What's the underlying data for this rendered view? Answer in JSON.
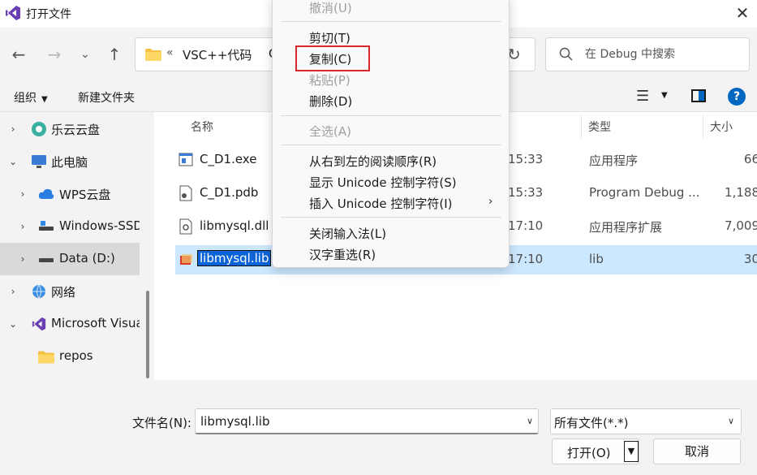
{
  "window": {
    "title": "打开文件"
  },
  "address": {
    "separator": "«",
    "crumb_1": "VSC++代码",
    "crumb_2": "C"
  },
  "search": {
    "placeholder": "在 Debug 中搜索"
  },
  "toolbar": {
    "organize": "组织",
    "new_folder": "新建文件夹"
  },
  "sidebar": {
    "items": [
      {
        "label": "乐云云盘",
        "icon": "cloud-icon",
        "expand": "collapsed"
      },
      {
        "label": "此电脑",
        "icon": "computer-icon",
        "expand": "expanded"
      },
      {
        "label": "WPS云盘",
        "icon": "cloud-icon",
        "expand": "collapsed"
      },
      {
        "label": "Windows-SSD",
        "icon": "drive-icon",
        "expand": "collapsed"
      },
      {
        "label": "Data (D:)",
        "icon": "drive-icon",
        "expand": "collapsed",
        "selected": true
      },
      {
        "label": "网络",
        "icon": "network-icon",
        "expand": "collapsed"
      },
      {
        "label": "Microsoft Visua",
        "icon": "visual-studio-icon",
        "expand": "expanded"
      },
      {
        "label": "repos",
        "icon": "folder-icon",
        "expand": "none"
      }
    ]
  },
  "columns": {
    "name": "名称",
    "type": "类型",
    "size": "大小"
  },
  "files": [
    {
      "name": "C_D1.exe",
      "date": "15:33",
      "type": "应用程序",
      "size": "66"
    },
    {
      "name": "C_D1.pdb",
      "date": "15:33",
      "type": "Program Debug ...",
      "size": "1,188"
    },
    {
      "name": "libmysql.dll",
      "date": "17:10",
      "type": "应用程序扩展",
      "size": "7,009"
    },
    {
      "name": "libmysql.lib",
      "date": "17:10",
      "type": "lib",
      "size": "30",
      "selected": true
    }
  ],
  "context_menu": {
    "undo": "撤消(U)",
    "cut": "剪切(T)",
    "copy": "复制(C)",
    "paste": "粘贴(P)",
    "delete": "删除(D)",
    "select_all": "全选(A)",
    "rtl": "从右到左的阅读顺序(R)",
    "show_unicode": "显示 Unicode 控制字符(S)",
    "insert_unicode": "插入 Unicode 控制字符(I)",
    "close_ime": "关闭输入法(L)",
    "reconvert": "汉字重选(R)",
    "highlighted_item": "copy"
  },
  "footer": {
    "filename_label": "文件名(N):",
    "filename_value": "libmysql.lib",
    "filetype_value": "所有文件(*.*)",
    "open": "打开(O)",
    "cancel": "取消"
  },
  "colors": {
    "accent": "#0067c0",
    "selection": "#cce8ff",
    "highlight_box": "#d9282f"
  }
}
